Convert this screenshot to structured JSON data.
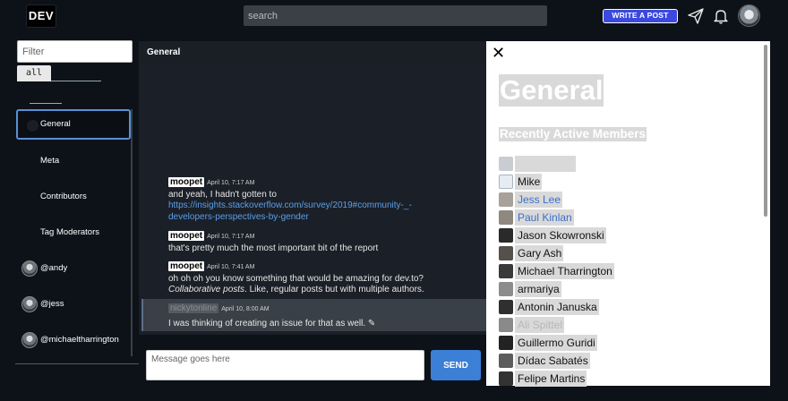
{
  "topbar": {
    "logo": "DEV",
    "search_placeholder": "search",
    "write_post": "WRITE A POST",
    "icons": [
      "paper-plane-icon",
      "bell-icon",
      "avatar"
    ]
  },
  "sidebar": {
    "filter_placeholder": "Filter",
    "tab_all": "all",
    "channels": [
      {
        "label": "General",
        "active": true
      },
      {
        "label": "Meta"
      },
      {
        "label": "Contributors"
      },
      {
        "label": "Tag Moderators"
      }
    ],
    "direct": [
      {
        "label": "@andy"
      },
      {
        "label": "@jess"
      },
      {
        "label": "@michaeltharrington"
      }
    ]
  },
  "chat": {
    "title": "General",
    "messages": [
      {
        "user": "moopet",
        "time": "April 10, 7:17 AM",
        "text": "and yeah, I hadn't gotten to",
        "link": "https://insights.stackoverflow.com/survey/2019#community-_-",
        "link2": "developers-perspectives-by-gender"
      },
      {
        "user": "moopet",
        "time": "April 10, 7:17 AM",
        "text": "that's pretty much the most important bit of the report"
      },
      {
        "user": "moopet",
        "time": "April 10, 7:41 AM",
        "text": "oh oh oh you know something that would be amazing for dev.to?",
        "em": "Collaborative posts",
        "text2": ". Like, regular posts but with multiple authors."
      },
      {
        "user": "nickytonline",
        "time": "April 10, 8:00 AM",
        "text": "I was thinking of creating an issue for that as well. ✎"
      }
    ],
    "input_placeholder": "Message goes here",
    "send": "SEND"
  },
  "right_panel": {
    "title": "General",
    "subtitle": "Recently Active Members",
    "members": [
      {
        "name": "nickytonline",
        "style": "hidden"
      },
      {
        "name": "Mike",
        "style": "normal"
      },
      {
        "name": "Jess Lee",
        "style": "link"
      },
      {
        "name": "Paul Kinlan",
        "style": "link"
      },
      {
        "name": "Jason Skowronski",
        "style": "normal"
      },
      {
        "name": "Gary Ash",
        "style": "normal"
      },
      {
        "name": "Michael Tharrington",
        "style": "normal"
      },
      {
        "name": "armariya",
        "style": "normal"
      },
      {
        "name": "Antonin Januska",
        "style": "normal"
      },
      {
        "name": "Ali Spittel",
        "style": "faded"
      },
      {
        "name": "Guillermo Guridi",
        "style": "normal"
      },
      {
        "name": "Dídac Sabatés",
        "style": "normal"
      },
      {
        "name": "Felipe Martins",
        "style": "normal"
      }
    ]
  },
  "colors": {
    "accent": "#3b49df",
    "send": "#3b7fd6",
    "link": "#5aa0e8",
    "bg": "#0d1219",
    "chat_bg": "#1b1f27"
  }
}
